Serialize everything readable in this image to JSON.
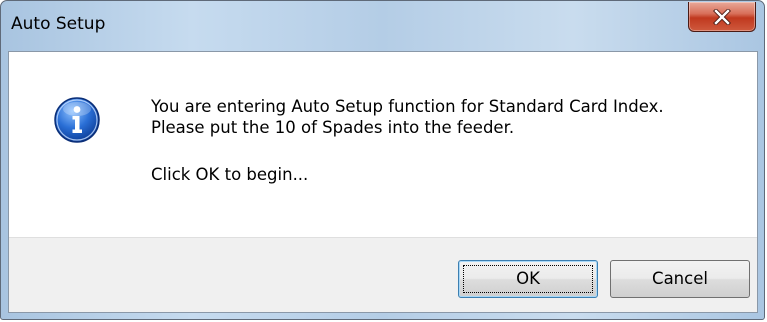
{
  "dialog": {
    "title": "Auto Setup",
    "close_icon": "close-icon",
    "info_icon": "information-icon",
    "message_lines": [
      "You are entering Auto Setup function for Standard Card Index.",
      "Please put the 10 of Spades into the feeder.",
      "Click OK to begin..."
    ],
    "buttons": {
      "ok_label": "OK",
      "cancel_label": "Cancel"
    },
    "colors": {
      "close_button": "#c7432a",
      "info_icon": "#1d5fbf",
      "footer_background": "#f0f0f0"
    }
  }
}
